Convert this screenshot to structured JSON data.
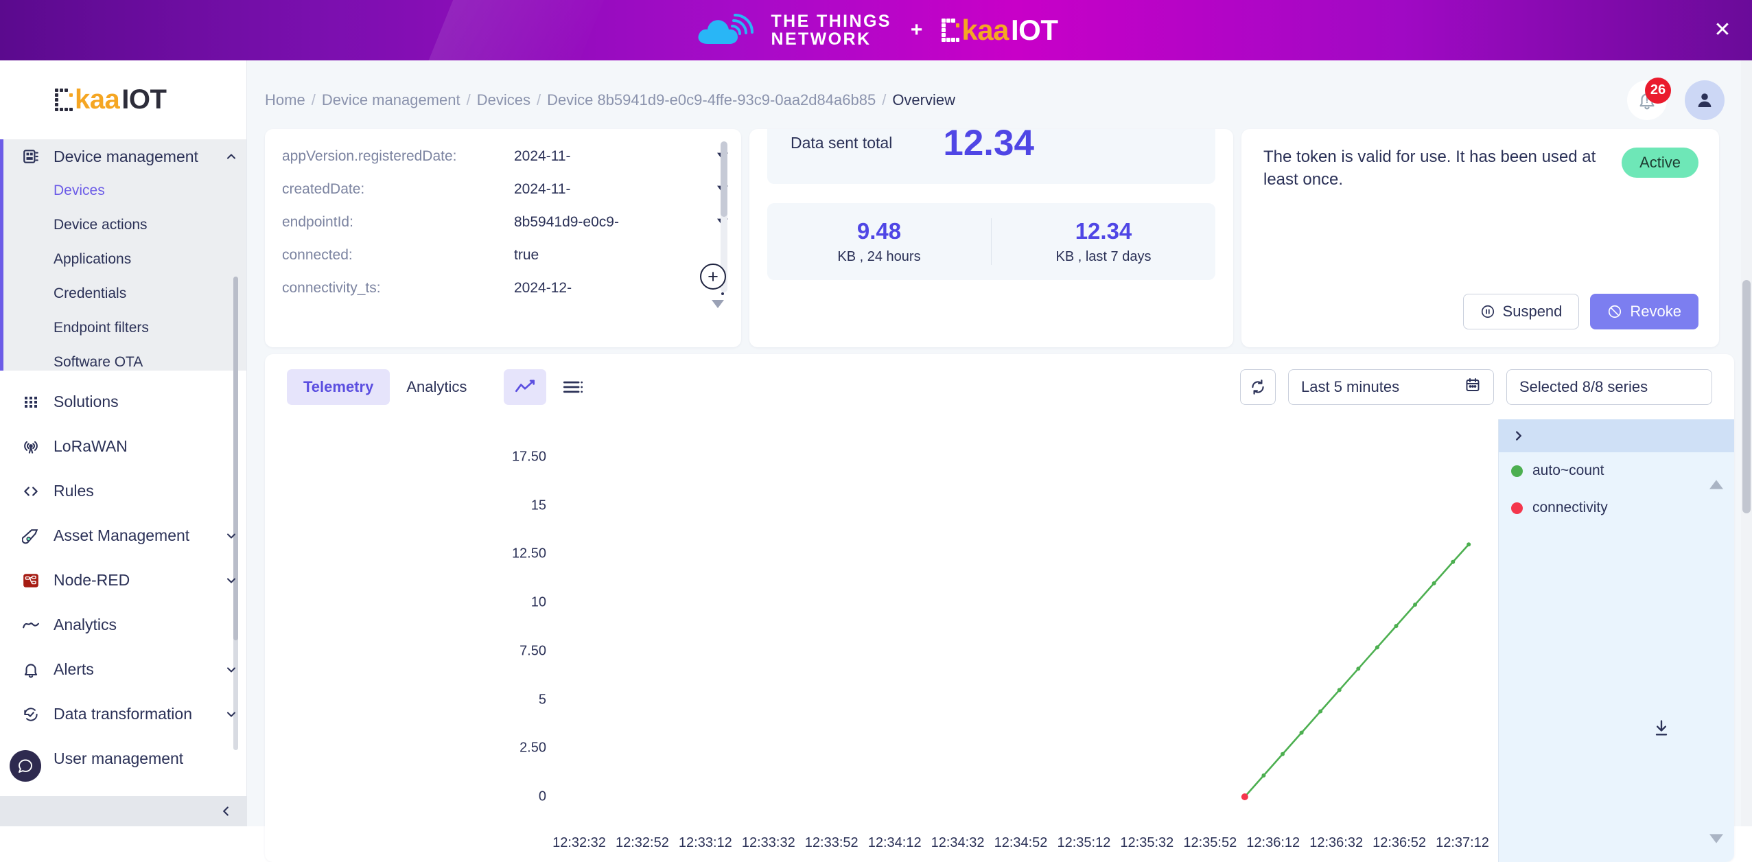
{
  "banner": {
    "ttn_line1": "THE THINGS",
    "ttn_line2": "NETWORK",
    "plus": "+",
    "kaa_word": "kaa",
    "kaa_suffix": "IOT",
    "close_icon": "close-icon"
  },
  "sidebar": {
    "logo_word": "kaa",
    "logo_suffix": "IOT",
    "groups": [
      {
        "label": "Device management",
        "icon": "device-management-icon",
        "expanded": true,
        "children": [
          {
            "label": "Devices",
            "active": true
          },
          {
            "label": "Device actions",
            "active": false
          },
          {
            "label": "Applications",
            "active": false
          },
          {
            "label": "Credentials",
            "active": false
          },
          {
            "label": "Endpoint filters",
            "active": false
          },
          {
            "label": "Software OTA",
            "active": false
          }
        ]
      },
      {
        "label": "Solutions",
        "icon": "grid-icon",
        "expanded": false,
        "children": []
      },
      {
        "label": "LoRaWAN",
        "icon": "antenna-icon",
        "expanded": false,
        "children": []
      },
      {
        "label": "Rules",
        "icon": "code-brackets-icon",
        "expanded": false,
        "children": []
      },
      {
        "label": "Asset Management",
        "icon": "asset-tag-icon",
        "expanded": false,
        "children": [],
        "has_chevron": true
      },
      {
        "label": "Node-RED",
        "icon": "node-red-icon",
        "expanded": false,
        "children": [],
        "has_chevron": true
      },
      {
        "label": "Analytics",
        "icon": "analytics-wave-icon",
        "expanded": false,
        "children": []
      },
      {
        "label": "Alerts",
        "icon": "bell-icon",
        "expanded": false,
        "children": [],
        "has_chevron": true
      },
      {
        "label": "Data transformation",
        "icon": "data-transform-icon",
        "expanded": false,
        "children": [],
        "has_chevron": true
      },
      {
        "label": "User management",
        "icon": "user-icon",
        "expanded": false,
        "children": []
      }
    ],
    "chat_icon": "chat-bubble-icon",
    "collapse_icon": "chevron-left-icon"
  },
  "topbar": {
    "breadcrumb": [
      {
        "label": "Home",
        "current": false
      },
      {
        "label": "Device management",
        "current": false
      },
      {
        "label": "Devices",
        "current": false
      },
      {
        "label": "Device 8b5941d9-e0c9-4ffe-93c9-0aa2d84a6b85",
        "current": false
      },
      {
        "label": "Overview",
        "current": true
      }
    ],
    "separator": "/",
    "notifications_count": "26",
    "notifications_icon": "bell-alert-icon",
    "account_icon": "user-avatar-icon"
  },
  "attributes_card": {
    "rows": [
      {
        "key": "appVersion.registeredDate:",
        "value": "2024-11-",
        "control": "caret"
      },
      {
        "key": "createdDate:",
        "value": "2024-11-",
        "control": "caret"
      },
      {
        "key": "endpointId:",
        "value": "8b5941d9-e0c9-",
        "control": "caret"
      },
      {
        "key": "connected:",
        "value": "true",
        "control": "kebab"
      },
      {
        "key": "connectivity_ts:",
        "value": "2024-12-",
        "control": "kebab"
      }
    ],
    "add_label": "+",
    "add_icon": "plus-circle-icon"
  },
  "data_card": {
    "total_label": "Data sent total",
    "total_value": "12.34",
    "stats": [
      {
        "value": "9.48",
        "label": "KB , 24 hours"
      },
      {
        "value": "12.34",
        "label": "KB , last 7 days"
      }
    ]
  },
  "token_card": {
    "message": "The token is valid for use. It has been used at least once.",
    "status": "Active",
    "status_color": "#6ee7b7",
    "suspend_label": "Suspend",
    "suspend_icon": "pause-circle-icon",
    "revoke_label": "Revoke",
    "revoke_icon": "ban-icon",
    "revoke_color": "#7c7ef0"
  },
  "telemetry": {
    "tabs": [
      {
        "label": "Telemetry",
        "active": true
      },
      {
        "label": "Analytics",
        "active": false
      }
    ],
    "view_toggles": [
      {
        "icon": "line-chart-icon",
        "active": true
      },
      {
        "icon": "list-view-icon",
        "active": false
      }
    ],
    "refresh_icon": "refresh-icon",
    "time_range": "Last 5 minutes",
    "calendar_icon": "calendar-icon",
    "series_selector": "Selected 8/8 series",
    "download_icon": "download-icon",
    "legend_expand_icon": "chevron-right-icon",
    "legend_up_icon": "caret-up-icon",
    "legend_down_icon": "caret-down-icon"
  },
  "chart_data": {
    "type": "line",
    "title": "",
    "xlabel": "",
    "ylabel": "",
    "grid": false,
    "legend_position": "right",
    "ylim": [
      0,
      17.5
    ],
    "ytick_labels": [
      "17.50",
      "15",
      "12.50",
      "10",
      "7.50",
      "5",
      "2.50",
      "0"
    ],
    "ytick_values": [
      17.5,
      15,
      12.5,
      10,
      7.5,
      5,
      2.5,
      0
    ],
    "xtick_labels": [
      "12:32:32",
      "12:32:52",
      "12:33:12",
      "12:33:32",
      "12:33:52",
      "12:34:12",
      "12:34:32",
      "12:34:52",
      "12:35:12",
      "12:35:32",
      "12:35:52",
      "12:36:12",
      "12:36:32",
      "12:36:52",
      "12:37:12"
    ],
    "series": [
      {
        "name": "auto~count",
        "color": "#4caf50",
        "x": [
          "12:36:03",
          "12:36:09",
          "12:36:15",
          "12:36:21",
          "12:36:27",
          "12:36:33",
          "12:36:39",
          "12:36:45",
          "12:36:51",
          "12:36:57",
          "12:37:03",
          "12:37:09",
          "12:37:14"
        ],
        "values": [
          0,
          1.1,
          2.2,
          3.3,
          4.4,
          5.5,
          6.6,
          7.7,
          8.8,
          9.9,
          11.0,
          12.1,
          13.0
        ]
      },
      {
        "name": "connectivity",
        "color": "#f4364c",
        "x": [
          "12:36:03"
        ],
        "values": [
          0
        ]
      }
    ],
    "legend": [
      {
        "label": "auto~count",
        "color": "#4caf50"
      },
      {
        "label": "connectivity",
        "color": "#f4364c"
      }
    ]
  }
}
